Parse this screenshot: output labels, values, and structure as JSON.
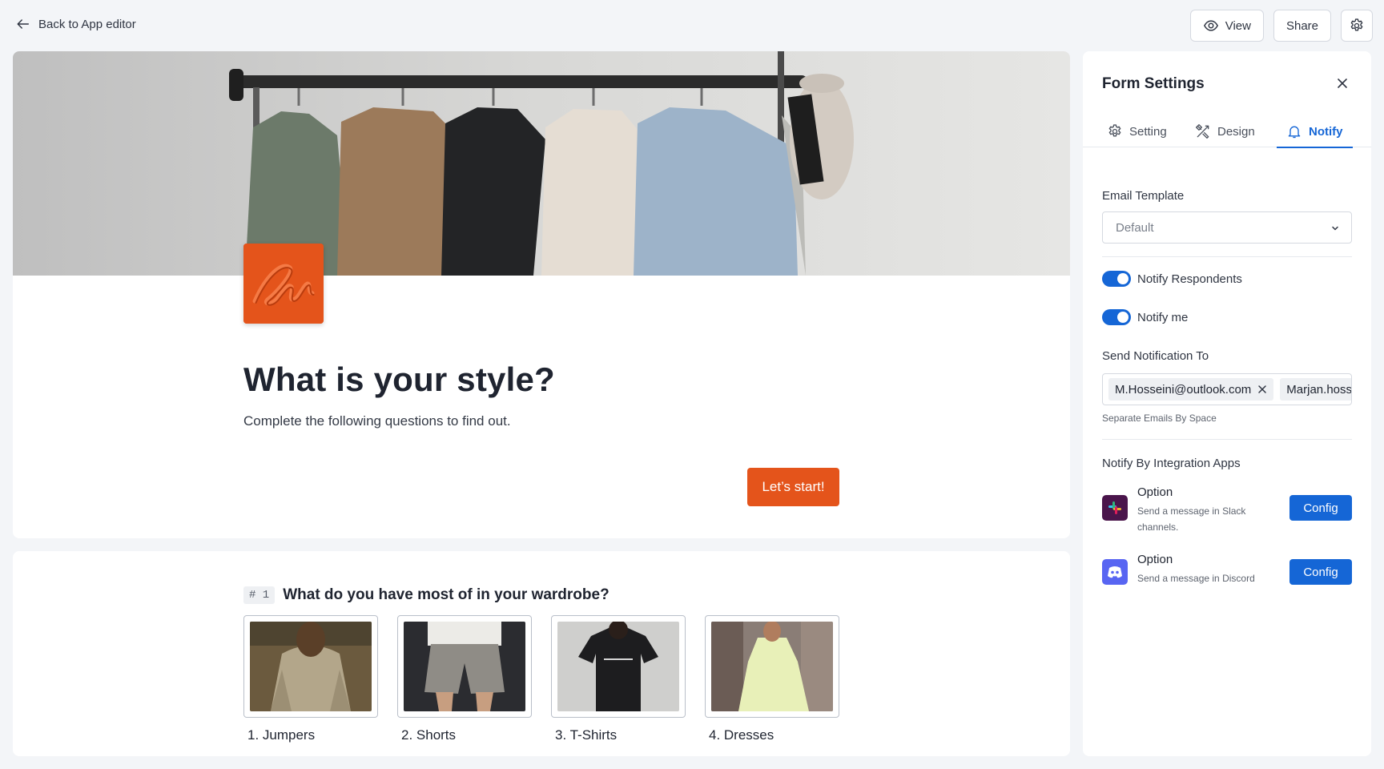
{
  "topbar": {
    "back_label": "Back to App editor",
    "view_label": "View",
    "share_label": "Share"
  },
  "form": {
    "logo_text": "Style",
    "title": "What is your style?",
    "subtitle": "Complete the following questions to find out.",
    "start_label": "Let’s start!",
    "accent_color": "#e4541b"
  },
  "question": {
    "number": "# 1",
    "text": "What do you have most of in your wardrobe?",
    "options": [
      {
        "label": "1. Jumpers"
      },
      {
        "label": "2. Shorts"
      },
      {
        "label": "3. T-Shirts"
      },
      {
        "label": "4. Dresses"
      }
    ]
  },
  "panel": {
    "title": "Form Settings",
    "tabs": [
      {
        "label": "Setting",
        "icon": "gear-icon"
      },
      {
        "label": "Design",
        "icon": "design-tools-icon"
      },
      {
        "label": "Notify",
        "icon": "bell-icon",
        "active": true
      }
    ],
    "email_template_label": "Email Template",
    "email_template_value": "Default",
    "toggles": [
      {
        "label": "Notify Respondents",
        "on": true
      },
      {
        "label": "Notify me",
        "on": true
      }
    ],
    "send_to_label": "Send Notification To",
    "emails": [
      "M.Hosseini@outlook.com",
      "Marjan.hosseini@gmail.com"
    ],
    "emails_hint": "Separate Emails By Space",
    "integrations_label": "Notify By Integration Apps",
    "integrations": [
      {
        "name": "Option",
        "desc": "Send a message in Slack channels.",
        "icon": "slack-icon",
        "button": "Config"
      },
      {
        "name": "Option",
        "desc": "Send a message in Discord",
        "icon": "discord-icon",
        "button": "Config"
      }
    ],
    "primary_color": "#1566d6"
  }
}
